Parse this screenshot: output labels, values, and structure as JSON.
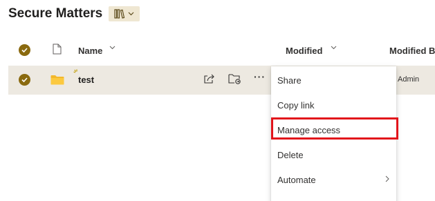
{
  "header": {
    "title": "Secure Matters",
    "library_switch_icon": "library-books-icon"
  },
  "columns": {
    "select_all_icon": "check-circle-icon",
    "file_type_icon": "document-icon",
    "name": "Name",
    "modified": "Modified",
    "modified_by": "Modified B"
  },
  "row": {
    "name": "test",
    "type_icon": "folder-icon",
    "modified_by": "Admin",
    "more": "···"
  },
  "menu": {
    "items": [
      {
        "label": "Share"
      },
      {
        "label": "Copy link"
      },
      {
        "label": "Manage access"
      },
      {
        "label": "Delete"
      },
      {
        "label": "Automate"
      }
    ]
  },
  "colors": {
    "accent": "#8a6a0f",
    "row_selected": "#ede9e1",
    "highlight_box": "#e2141b",
    "library_switch_bg": "#efe7d2"
  }
}
